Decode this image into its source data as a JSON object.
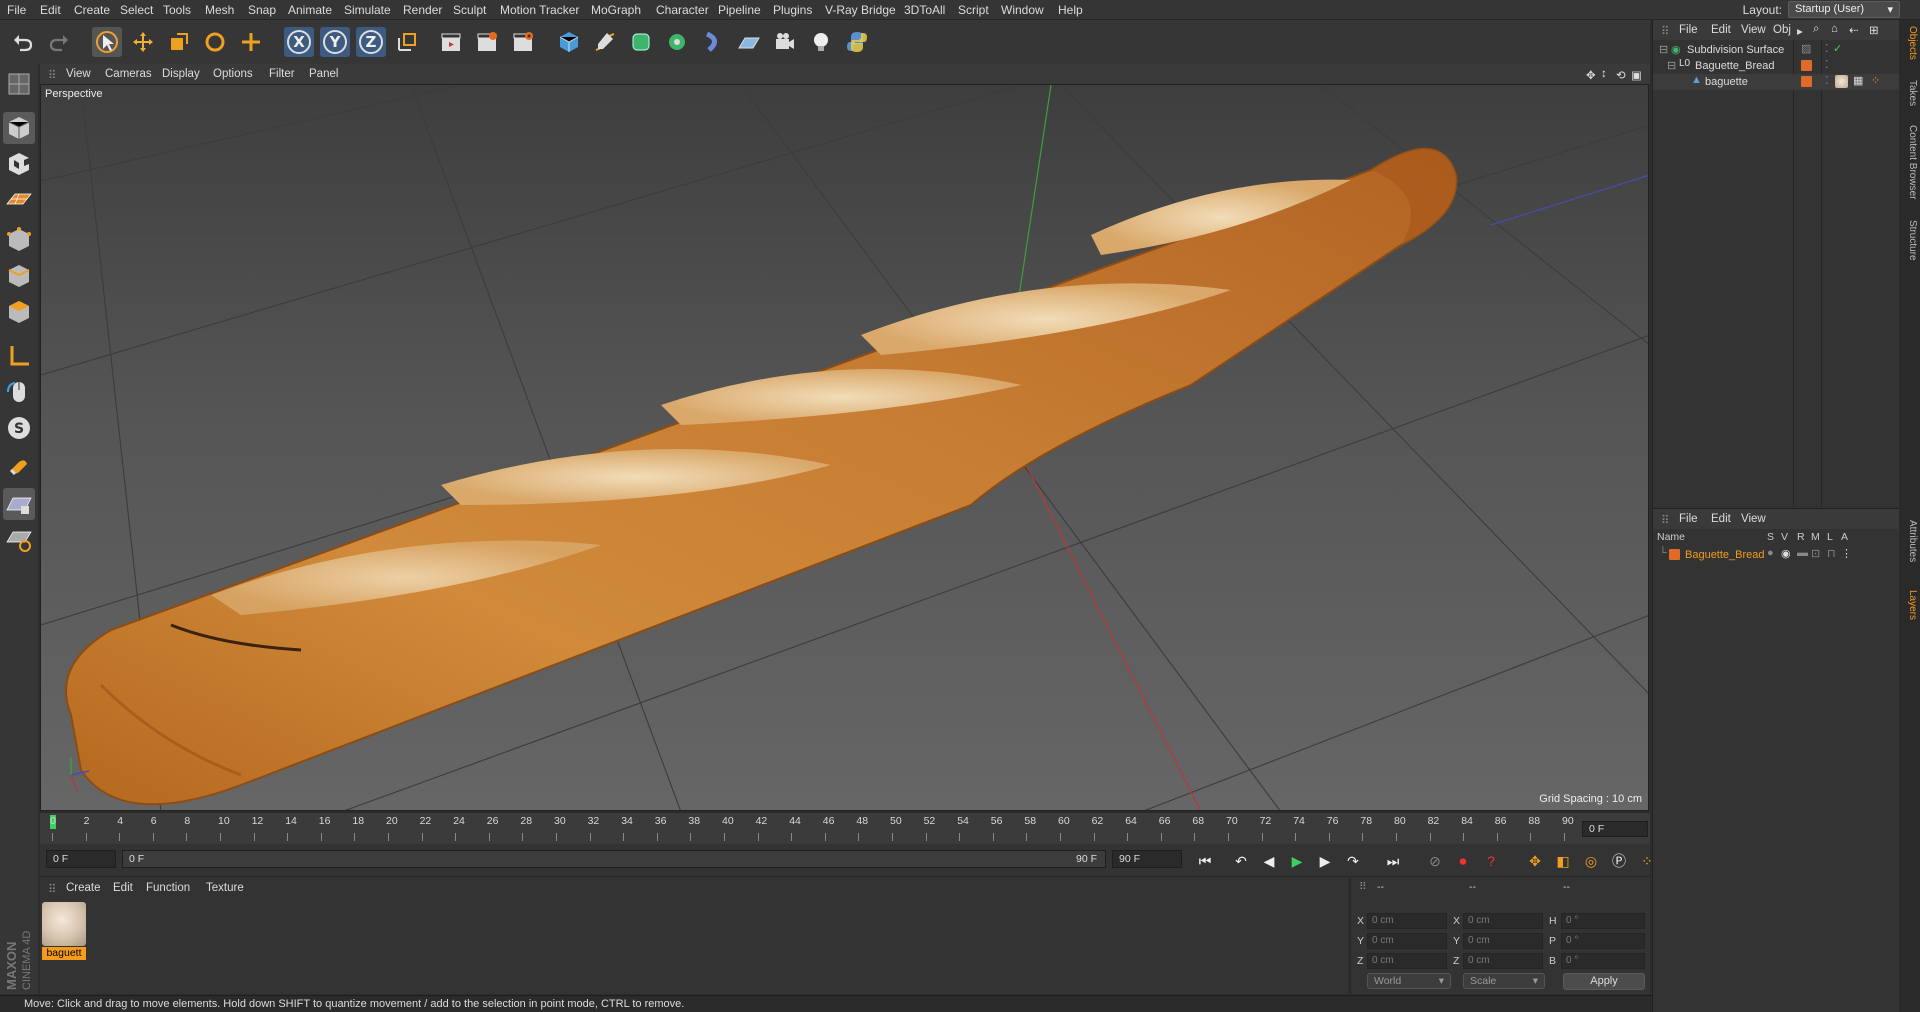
{
  "menubar": {
    "items": [
      "File",
      "Edit",
      "Create",
      "Select",
      "Tools",
      "Mesh",
      "Snap",
      "Animate",
      "Simulate",
      "Render",
      "Sculpt",
      "Motion Tracker",
      "MoGraph",
      "Character",
      "Pipeline",
      "Plugins",
      "V-Ray Bridge",
      "3DToAll",
      "Script",
      "Window",
      "Help"
    ],
    "layout_label": "Layout:",
    "layout_value": "Startup (User)"
  },
  "toolbar": {
    "axis_x": "X",
    "axis_y": "Y",
    "axis_z": "Z"
  },
  "viewport": {
    "menu": [
      "View",
      "Cameras",
      "Display",
      "Options",
      "Filter",
      "Panel"
    ],
    "label": "Perspective",
    "grid_spacing": "Grid Spacing : 10 cm"
  },
  "timeline": {
    "ticks": [
      "0",
      "2",
      "4",
      "6",
      "8",
      "10",
      "12",
      "14",
      "16",
      "18",
      "20",
      "22",
      "24",
      "26",
      "28",
      "30",
      "32",
      "34",
      "36",
      "38",
      "40",
      "42",
      "44",
      "46",
      "48",
      "50",
      "52",
      "54",
      "56",
      "58",
      "60",
      "62",
      "64",
      "66",
      "68",
      "70",
      "72",
      "74",
      "76",
      "78",
      "80",
      "82",
      "84",
      "86",
      "88",
      "90"
    ],
    "current_frame": "0 F"
  },
  "transport": {
    "start_field": "0 F",
    "range_start": "0 F",
    "range_end": "90 F",
    "end_field": "90 F"
  },
  "material_panel": {
    "menu": [
      "Create",
      "Edit",
      "Function",
      "Texture"
    ],
    "material_name": "baguett"
  },
  "coordinates": {
    "header": [
      "--",
      "--",
      "--"
    ],
    "rows": [
      {
        "label": "X",
        "pos": "0 cm",
        "label2": "X",
        "size": "0 cm",
        "label3": "H",
        "rot": "0 °"
      },
      {
        "label": "Y",
        "pos": "0 cm",
        "label2": "Y",
        "size": "0 cm",
        "label3": "P",
        "rot": "0 °"
      },
      {
        "label": "Z",
        "pos": "0 cm",
        "label2": "Z",
        "size": "0 cm",
        "label3": "B",
        "rot": "0 °"
      }
    ],
    "mode": "World",
    "transform": "Scale",
    "apply": "Apply"
  },
  "status_text": "Move: Click and drag to move elements. Hold down SHIFT to quantize movement / add to the selection in point mode, CTRL to remove.",
  "brand": {
    "maxon": "MAXON",
    "product": "CINEMA 4D"
  },
  "object_manager": {
    "menu": [
      "File",
      "Edit",
      "View",
      "Obj"
    ],
    "objects": [
      {
        "name": "Subdivision Surface"
      },
      {
        "name": "Baguette_Bread"
      },
      {
        "name": "baguette"
      }
    ]
  },
  "layer_manager": {
    "menu": [
      "File",
      "Edit",
      "View"
    ],
    "columns": [
      "Name",
      "S",
      "V",
      "R",
      "M",
      "L",
      "A"
    ],
    "layers": [
      {
        "name": "Baguette_Bread"
      }
    ]
  },
  "side_tabs": [
    "Objects",
    "Takes",
    "Content Browser",
    "Structure",
    "Attributes",
    "Layers"
  ],
  "colors": {
    "accent": "#f59c1d",
    "layer_color": "#e06a28",
    "selected_text": "#f59c1d"
  }
}
